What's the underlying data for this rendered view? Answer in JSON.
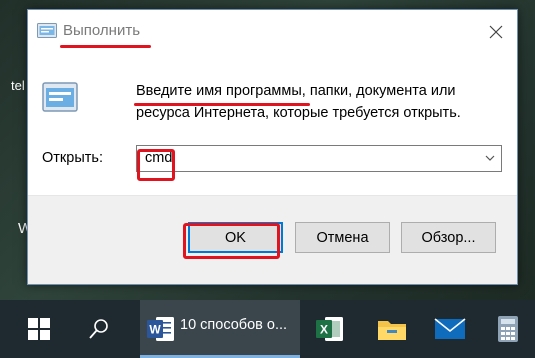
{
  "desktop": {
    "partial_text_1": "tel",
    "partial_text_2": "W"
  },
  "dialog": {
    "title": "Выполнить",
    "description": "Введите имя программы, папки, документа или ресурса Интернета, которые требуется открыть.",
    "open_label": "Открыть:",
    "open_value": "cmd",
    "buttons": {
      "ok": "OK",
      "cancel": "Отмена",
      "browse": "Обзор..."
    },
    "icons": {
      "title": "run-app-icon",
      "body": "run-app-icon",
      "close": "close-icon",
      "dropdown": "chevron-down-icon"
    }
  },
  "annotation": {
    "color": "#e0141e"
  },
  "taskbar": {
    "items": [
      {
        "name": "start",
        "icon": "windows-logo-icon"
      },
      {
        "name": "search",
        "icon": "search-icon"
      },
      {
        "name": "word",
        "icon": "word-icon",
        "label": "10 способов о..."
      },
      {
        "name": "excel",
        "icon": "excel-icon"
      },
      {
        "name": "explorer",
        "icon": "folder-icon"
      },
      {
        "name": "mail",
        "icon": "mail-icon"
      },
      {
        "name": "calculator",
        "icon": "calculator-icon"
      }
    ]
  }
}
